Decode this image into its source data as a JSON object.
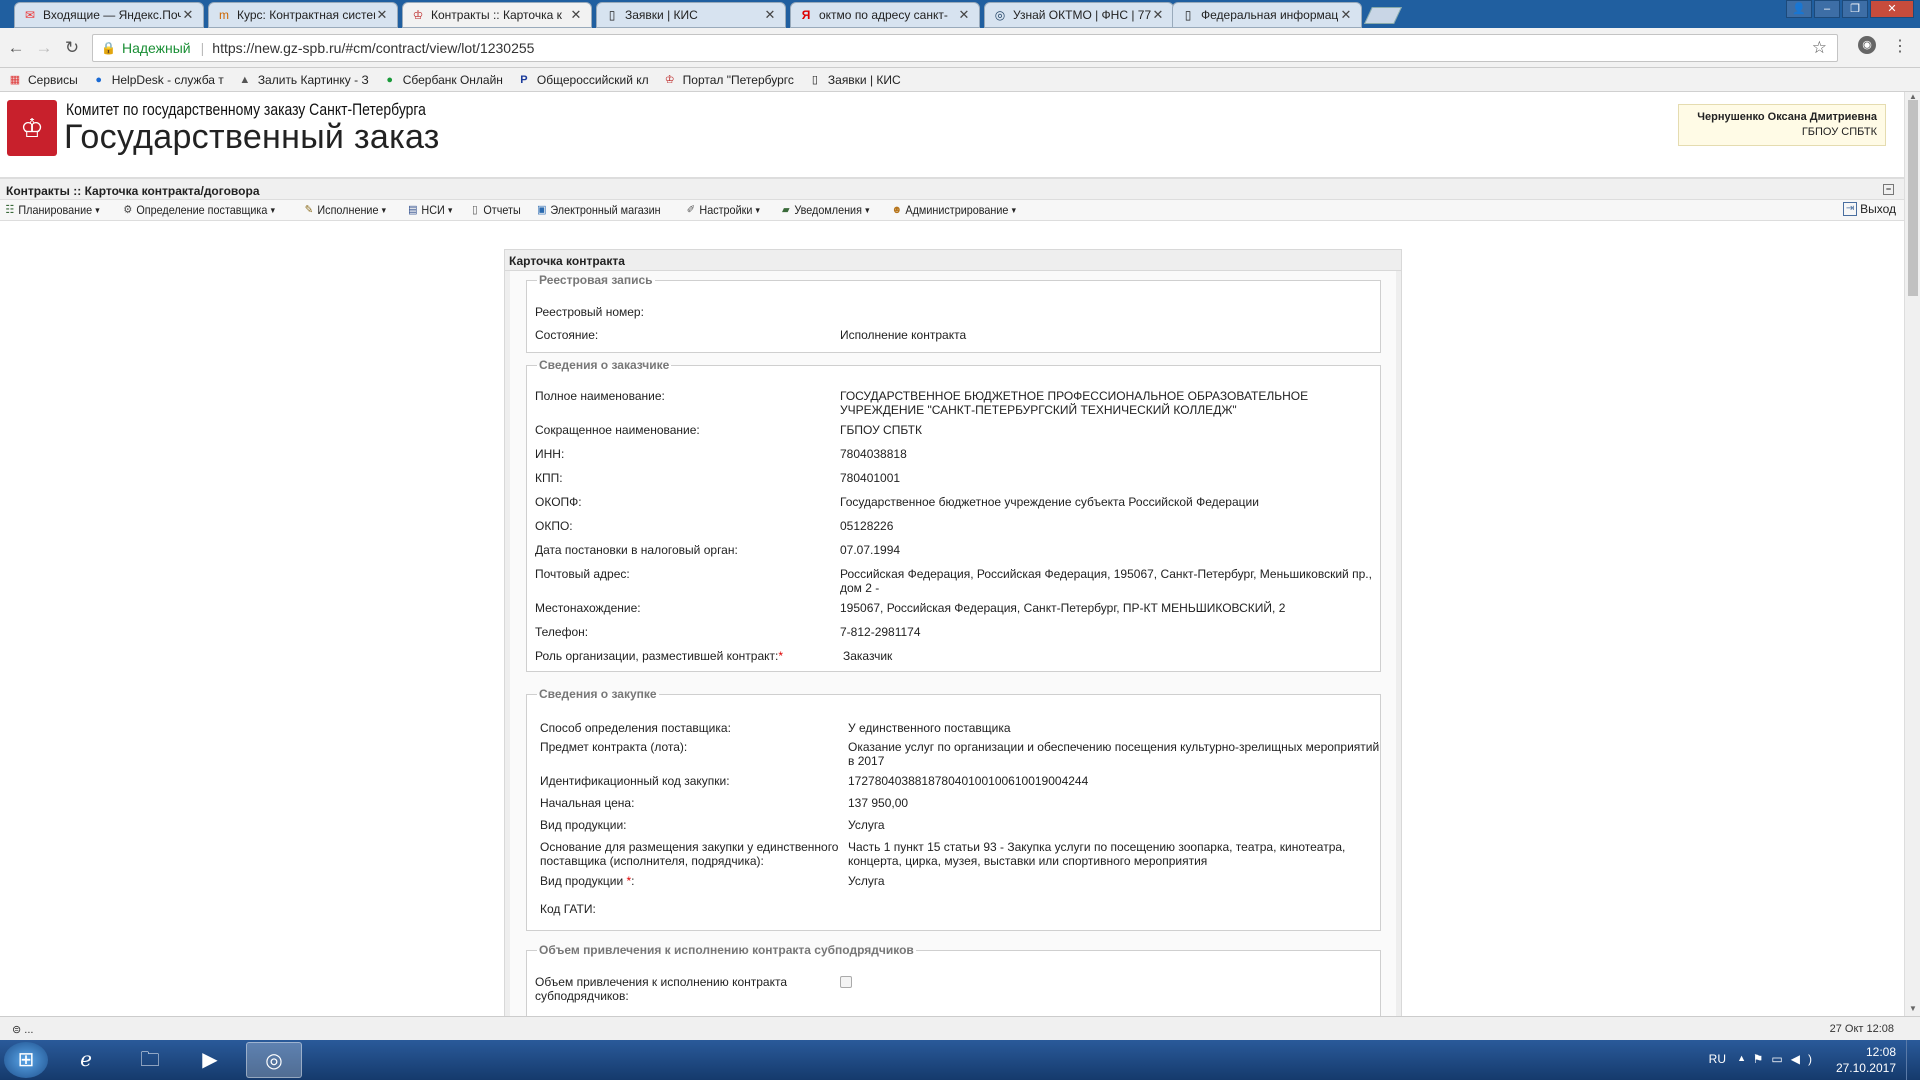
{
  "browser": {
    "tabs": [
      {
        "label": "Входящие — Яндекс.Почта",
        "icon": "mail-icon"
      },
      {
        "label": "Курс: Контрактная система",
        "icon": "course-icon"
      },
      {
        "label": "Контракты :: Карточка к",
        "icon": "gz-icon"
      },
      {
        "label": "Заявки | КИС",
        "icon": "page-icon"
      },
      {
        "label": "октмо по адресу санкт-",
        "icon": "yandex-icon"
      },
      {
        "label": "Узнай ОКТМО | ФНС | 77",
        "icon": "fns-icon"
      },
      {
        "label": "Федеральная информац",
        "icon": "page-icon"
      }
    ],
    "secure_label": "Надежный",
    "url": "https://new.gz-spb.ru/#cm/contract/view/lot/1230255",
    "bookmarks": [
      {
        "label": "Сервисы"
      },
      {
        "label": "HelpDesk - служба т"
      },
      {
        "label": "Залить Картинку - З"
      },
      {
        "label": "Сбербанк Онлайн"
      },
      {
        "label": "Общероссийский кл"
      },
      {
        "label": "Портал \"Петербургс"
      },
      {
        "label": "Заявки | КИС"
      }
    ]
  },
  "header": {
    "org_name": "Комитет по государственному заказу Санкт-Петербурга",
    "site_title": "Государственный заказ",
    "user_name": "Чернушенко Оксана Дмитриевна",
    "user_org": "ГБПОУ СПБТК"
  },
  "pagebar": {
    "title": "Контракты :: Карточка контракта/договора"
  },
  "menu": {
    "items": [
      {
        "label": "Планирование"
      },
      {
        "label": "Определение поставщика"
      },
      {
        "label": "Исполнение"
      },
      {
        "label": "НСИ"
      },
      {
        "label": "Отчеты"
      },
      {
        "label": "Электронный магазин"
      },
      {
        "label": "Настройки"
      },
      {
        "label": "Уведомления"
      },
      {
        "label": "Администрирование"
      }
    ],
    "logout": "Выход"
  },
  "card": {
    "title": "Карточка контракта",
    "registry": {
      "legend": "Реестровая запись",
      "rows": [
        {
          "label": "Реестровый номер:",
          "value": ""
        },
        {
          "label": "Состояние:",
          "value": "Исполнение контракта"
        }
      ]
    },
    "customer": {
      "legend": "Сведения о заказчике",
      "rows": [
        {
          "label": "Полное наименование:",
          "value": "ГОСУДАРСТВЕННОЕ БЮДЖЕТНОЕ ПРОФЕССИОНАЛЬНОЕ ОБРАЗОВАТЕЛЬНОЕ УЧРЕЖДЕНИЕ \"САНКТ-ПЕТЕРБУРГСКИЙ ТЕХНИЧЕСКИЙ КОЛЛЕДЖ\""
        },
        {
          "label": "Сокращенное наименование:",
          "value": "ГБПОУ СПБТК"
        },
        {
          "label": "ИНН:",
          "value": "7804038818"
        },
        {
          "label": "КПП:",
          "value": "780401001"
        },
        {
          "label": "ОКОПФ:",
          "value": "Государственное бюджетное учреждение субъекта Российской Федерации"
        },
        {
          "label": "ОКПО:",
          "value": "05128226"
        },
        {
          "label": "Дата постановки в налоговый орган:",
          "value": "07.07.1994"
        },
        {
          "label": "Почтовый адрес:",
          "value": "Российская Федерация, Российская Федерация, 195067, Санкт-Петербург, Меньшиковский пр., дом 2 -"
        },
        {
          "label": "Местонахождение:",
          "value": "195067, Российская Федерация, Санкт-Петербург, ПР-КТ МЕНЬШИКОВСКИЙ, 2"
        },
        {
          "label": "Телефон:",
          "value": "7-812-2981174"
        },
        {
          "label": "Роль организации, разместившей контракт:",
          "value": "Заказчик"
        }
      ]
    },
    "purchase": {
      "legend": "Сведения о закупке",
      "rows": [
        {
          "label": "Способ определения поставщика:",
          "value": "У единственного поставщика"
        },
        {
          "label": "Предмет контракта (лота):",
          "value": "Оказание услуг по организации и обеспечению посещения культурно-зрелищных мероприятий в 2017"
        },
        {
          "label": "Идентификационный код закупки:",
          "value": "172780403881878040100100610019004244"
        },
        {
          "label": "Начальная цена:",
          "value": "137 950,00"
        },
        {
          "label": "Вид продукции:",
          "value": "Услуга"
        },
        {
          "label": "Основание для размещения закупки у единственного поставщика (исполнителя, подрядчика):",
          "value": "Часть 1 пункт 15 статьи 93 - Закупка услуги по посещению зоопарка, театра, кинотеатра, концерта, цирка, музея, выставки или спортивного мероприятия"
        },
        {
          "label": "Вид продукции",
          "value": "Услуга"
        },
        {
          "label": "Код ГАТИ:",
          "value": ""
        }
      ]
    },
    "subcontract": {
      "legend": "Объем привлечения к исполнению контракта субподрядчиков",
      "label": "Объем привлечения к исполнению контракта субподрядчиков:"
    }
  },
  "statusbar": {
    "left": "...",
    "right": "27 Окт 12:08"
  },
  "taskbar": {
    "lang": "RU",
    "time": "12:08",
    "date": "27.10.2017"
  }
}
